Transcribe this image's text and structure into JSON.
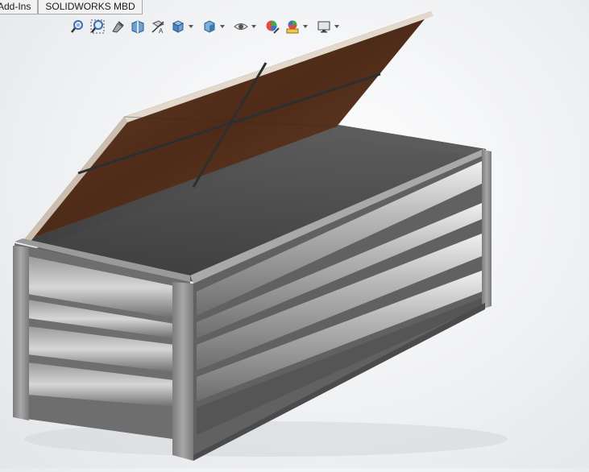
{
  "tabs": [
    {
      "label": "Add-Ins"
    },
    {
      "label": "SOLIDWORKS MBD"
    }
  ],
  "heads_up_toolbar": {
    "buttons": [
      {
        "icon": "zoom-to-fit-icon"
      },
      {
        "icon": "zoom-to-area-icon"
      },
      {
        "icon": "previous-view-icon"
      },
      {
        "icon": "section-view-icon"
      },
      {
        "icon": "dynamic-annotation-views-icon"
      },
      {
        "icon": "view-orientation-icon"
      },
      {
        "icon": "display-style-icon"
      },
      {
        "icon": "hide-show-items-icon"
      },
      {
        "icon": "edit-appearance-icon"
      },
      {
        "icon": "apply-scene-icon"
      },
      {
        "icon": "view-settings-icon"
      }
    ]
  },
  "model": {
    "name": "storage-box-with-open-lid",
    "colors": {
      "lid_wood": "#5a3420",
      "lid_edge": "#d8cfc2",
      "frame_steel": "#8c8c8c",
      "interior": "#4a4a4a",
      "slat_highlight": "#e8e8e8"
    }
  }
}
